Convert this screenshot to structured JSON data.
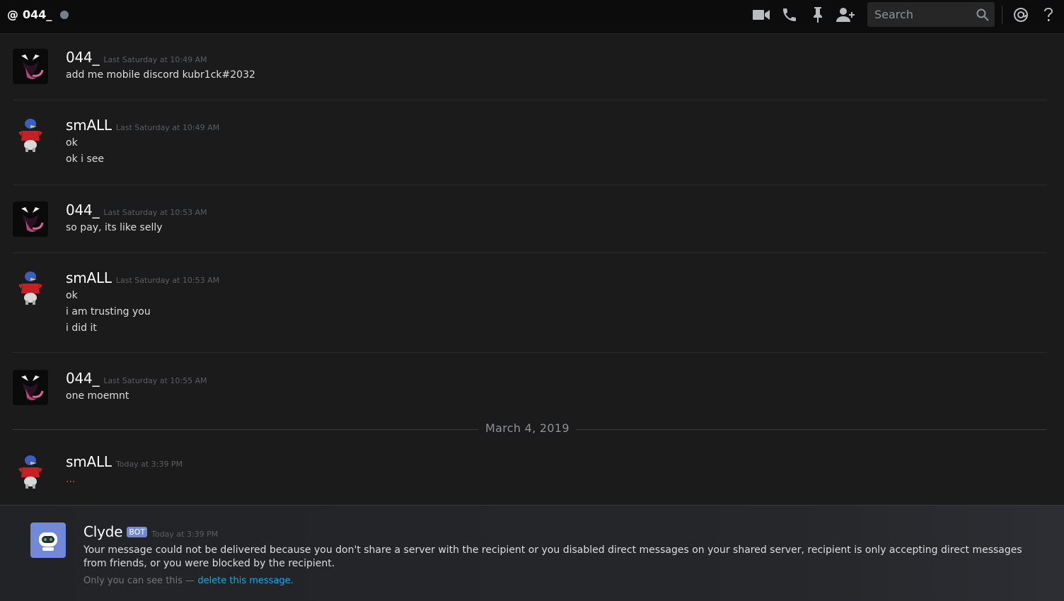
{
  "header": {
    "channel_prefix": "@",
    "channel_name": "044_",
    "search_placeholder": "Search",
    "icons": [
      "video-call-icon",
      "voice-call-icon",
      "pin-icon",
      "add-friend-icon",
      "search-icon",
      "mention-icon",
      "help-icon"
    ]
  },
  "messages": [
    {
      "author": "044_",
      "time": "Last Saturday at 10:49 AM",
      "lines": [
        "add me mobile discord kubr1ck#2032"
      ],
      "avatar": "venom"
    },
    {
      "author": "smALL",
      "time": "Last Saturday at 10:49 AM",
      "lines": [
        "ok",
        "ok i see"
      ],
      "avatar": "penguin"
    },
    {
      "author": "044_",
      "time": "Last Saturday at 10:53 AM",
      "lines": [
        "so pay, its like selly"
      ],
      "avatar": "venom"
    },
    {
      "author": "smALL",
      "time": "Last Saturday at 10:53 AM",
      "lines": [
        "ok",
        "i am trusting you",
        "i did it"
      ],
      "avatar": "penguin"
    },
    {
      "author": "044_",
      "time": "Last Saturday at 10:55 AM",
      "lines": [
        "one moemnt"
      ],
      "avatar": "venom"
    },
    {
      "author": "smALL",
      "time": "Today at 3:39 PM",
      "lines": [
        "..."
      ],
      "avatar": "penguin"
    }
  ],
  "date_divider": "March 4, 2019",
  "bot_message": {
    "author": "Clyde",
    "tag": "BOT",
    "time": "Today at 3:39 PM",
    "text": "Your message could not be delivered because you don't share a server with the recipient or you disabled direct messages on your shared server, recipient is only accepting direct messages from friends, or you were blocked by the recipient.",
    "note_prefix": "Only you can see this — ",
    "note_link": "delete this message."
  },
  "colors": {
    "accent": "#7289da",
    "link": "#00b0f4",
    "background": "#1b1b1b",
    "header": "#0c0c0c"
  }
}
